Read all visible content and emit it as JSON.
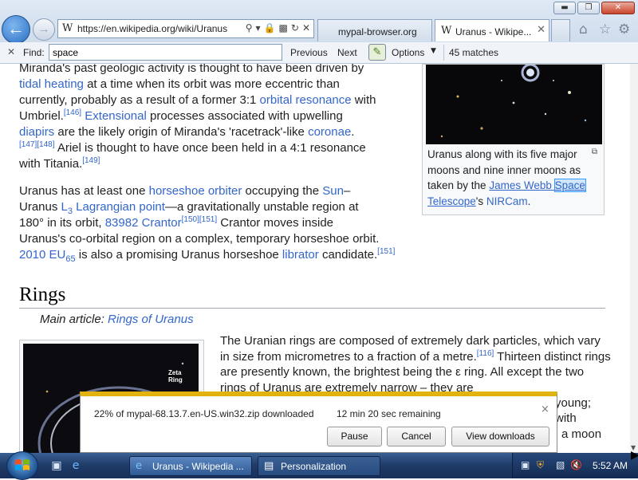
{
  "window": {
    "minimize": "▬",
    "restore": "❐",
    "close": "✕"
  },
  "nav": {
    "back_icon": "arrow-left",
    "forward_icon": "arrow-right"
  },
  "address": {
    "site_letter": "W",
    "url": "https://en.wikipedia.org/wiki/Uranus"
  },
  "tabs": [
    {
      "label": "mypal-browser.org",
      "active": false
    },
    {
      "label": "Uranus - Wikipe...",
      "site_letter": "W",
      "active": true
    }
  ],
  "findbar": {
    "label": "Find:",
    "query": "space",
    "previous": "Previous",
    "next": "Next",
    "options": "Options",
    "matches": "45 matches"
  },
  "article": {
    "p1_lines": [
      "Miranda's past geologic activity is thought to have been driven by",
      "tidal heating",
      " at a time when its orbit was more eccentric than",
      "currently, probably as a result of a former 3:1 ",
      "orbital resonance",
      " with",
      "Umbriel.",
      "[146]",
      "Extensional",
      " processes associated with upwelling",
      "diapirs",
      " are the likely origin of Miranda's 'racetrack'-like ",
      "coronae",
      "[147][148]",
      " Ariel is thought to have once been held in a 4:1 resonance",
      "with Titania.",
      "[149]"
    ],
    "p2": {
      "t1": "Uranus has at least one ",
      "l1": "horseshoe orbiter",
      "t2": " occupying the ",
      "l2": "Sun",
      "t3": "–",
      "t4": "Uranus ",
      "l3a": "L",
      "l3sub": "3",
      "l3b": " Lagrangian point",
      "t5": "—a gravitationally unstable region at",
      "t6": "180° in its orbit, ",
      "l4": "83982 Crantor",
      "s1": "[150][151]",
      "t7": " Crantor moves inside",
      "t8": "Uranus's co-orbital region on a complex, temporary horseshoe orbit.",
      "l5": "2010 EU",
      "l5sub": "65",
      "t9": " is also a promising Uranus horseshoe ",
      "l6": "librator",
      "t10": " candidate.",
      "s2": "[151]"
    },
    "infobox": {
      "caption_1": "Uranus along with its five major moons and nine inner moons as taken by the ",
      "caption_link": "James Webb ",
      "caption_highlight": "Space",
      "caption_link2": "Telescope",
      "caption_2": "'s ",
      "caption_link3": "NIRCam",
      "caption_3": "."
    },
    "rings_heading": "Rings",
    "main_article_label": "Main article: ",
    "main_article_link": "Rings of Uranus",
    "rings_image_label": "Zeta\nRing",
    "rings_text_1": "The Uranian rings are composed of extremely dark particles, which vary in size from micrometres to a fraction of a metre.",
    "rings_sup": "[116]",
    "rings_text_2": " Thirteen distinct rings are presently known, the brightest being the ε ring. All except the two rings of Uranus are extremely narrow – they are",
    "rings_tail_1": "young;",
    "rings_tail_2": "with",
    "rings_tail_3": "a moon"
  },
  "download": {
    "status": "22% of mypal-68.13.7.en-US.win32.zip downloaded",
    "progress": 0.22,
    "remaining": "12 min 20 sec remaining",
    "pause": "Pause",
    "cancel": "Cancel",
    "view": "View downloads",
    "close": "×"
  },
  "taskbar": {
    "tasks": [
      {
        "label": "Uranus - Wikipedia ...",
        "icon": "ie-icon"
      },
      {
        "label": "Personalization",
        "icon": "control-panel-icon"
      }
    ],
    "clock": "5:52 AM"
  }
}
